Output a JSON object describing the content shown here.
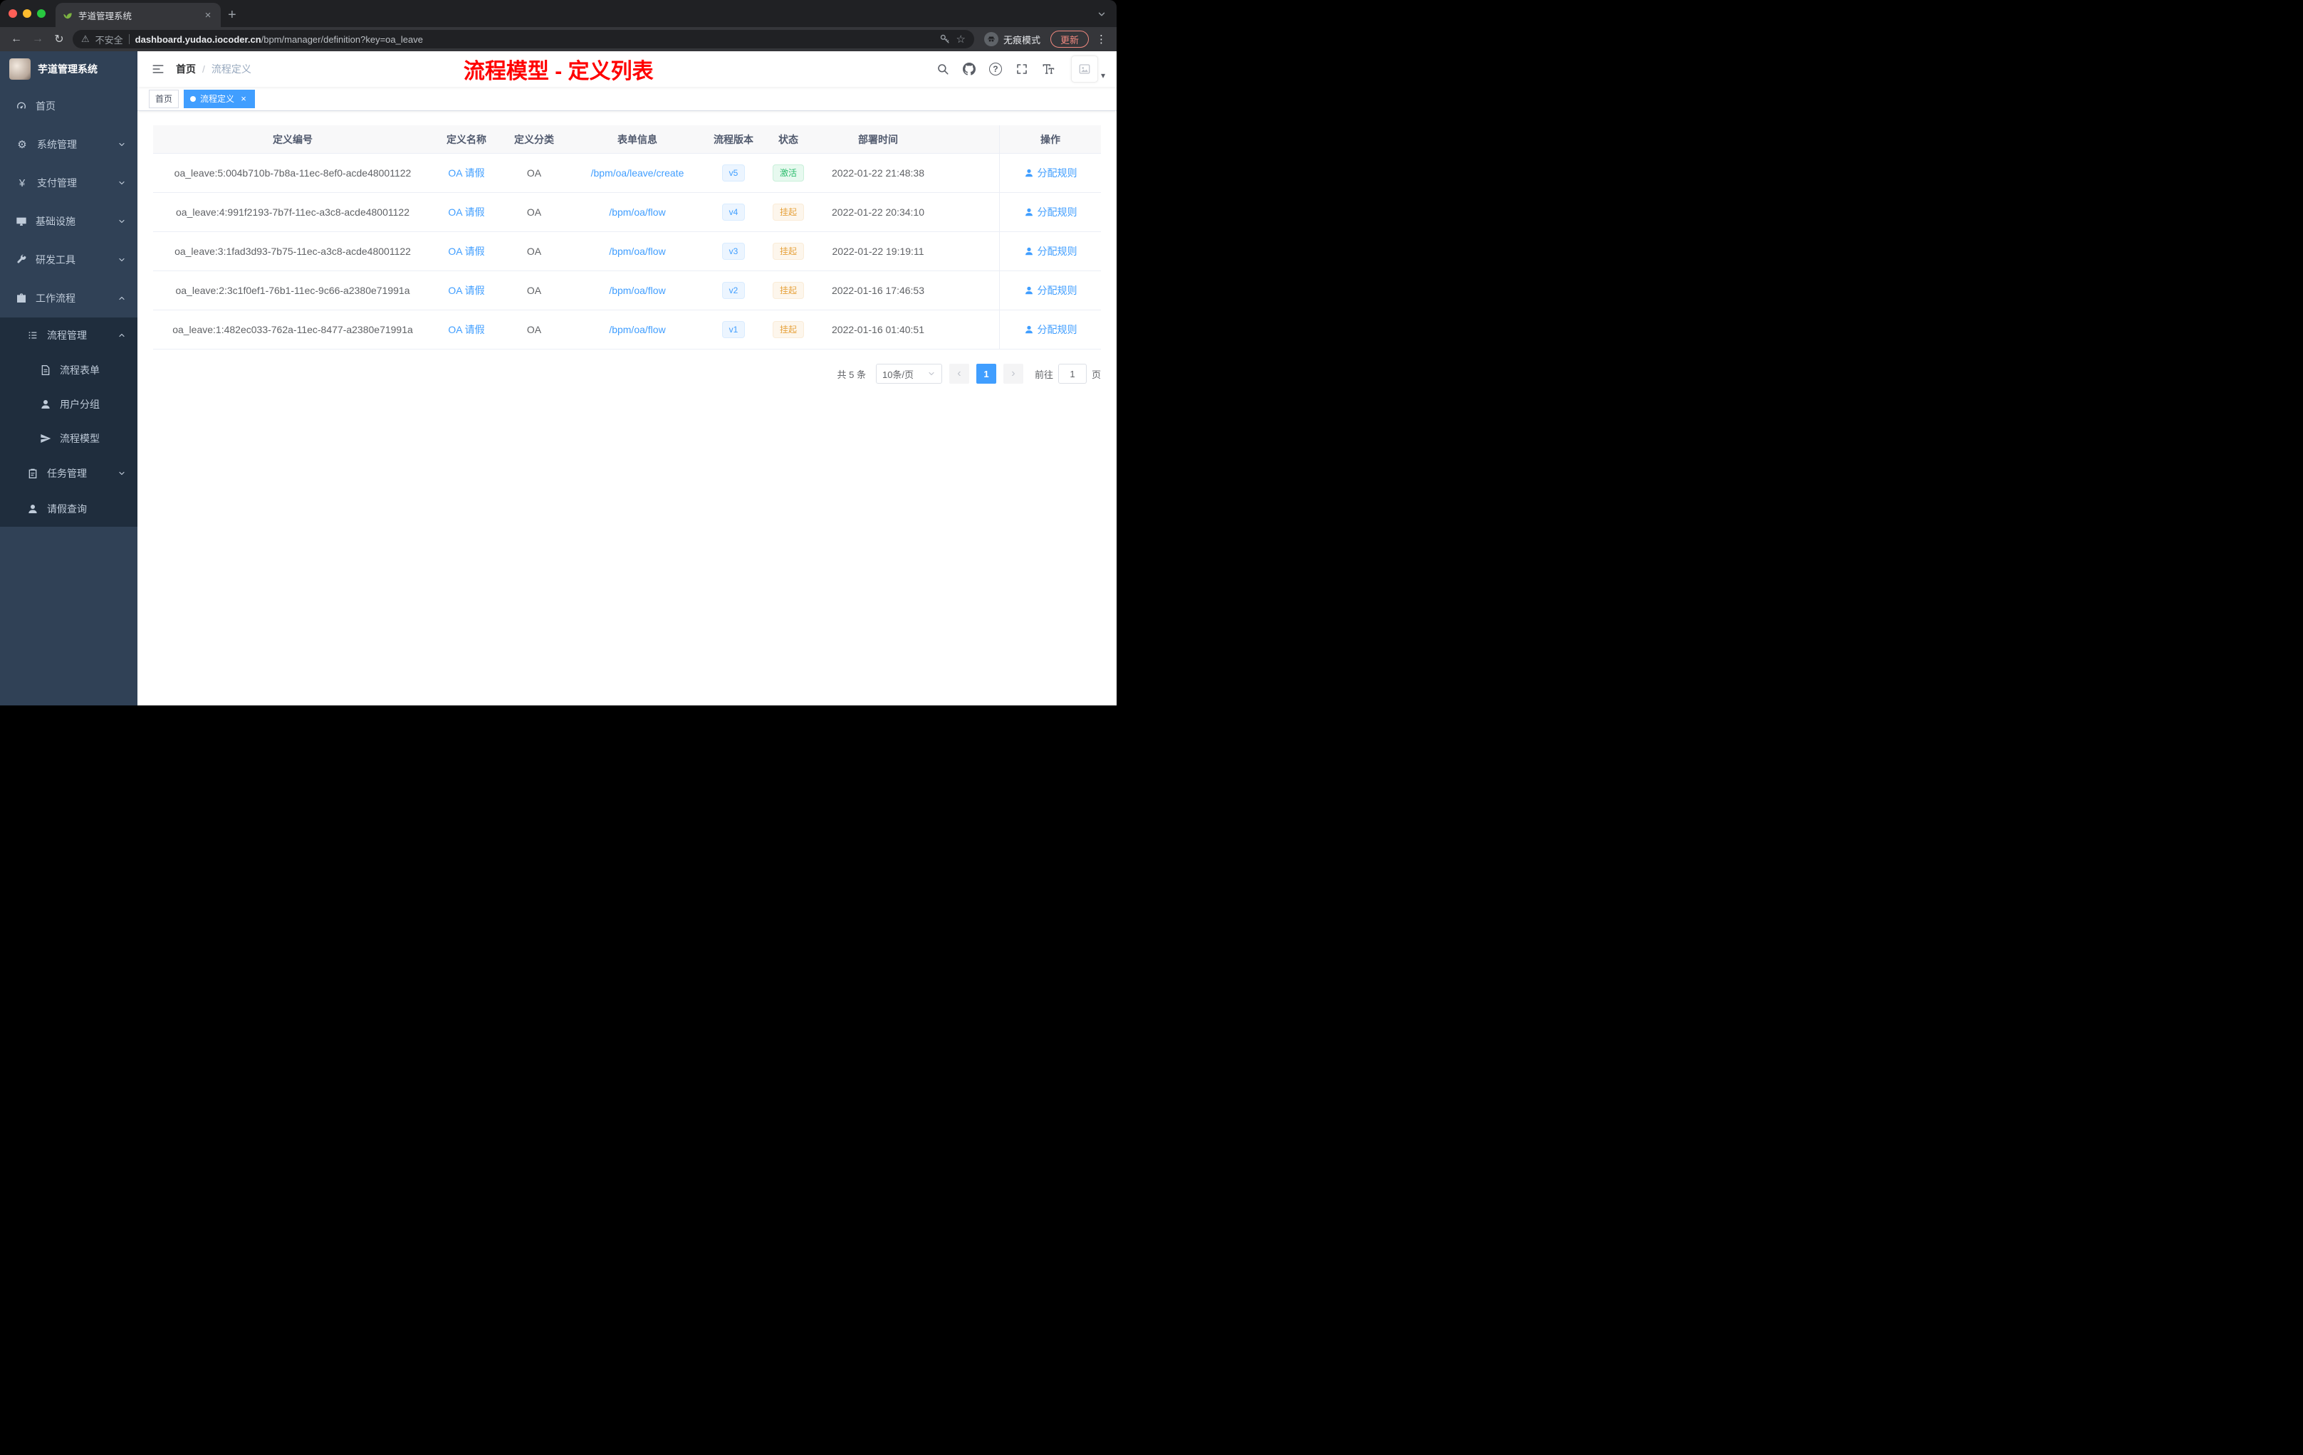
{
  "browser": {
    "tab_title": "芋道管理系统",
    "security_label": "不安全",
    "url_domain": "dashboard.yudao.iocoder.cn",
    "url_path": "/bpm/manager/definition?key=oa_leave",
    "incognito_label": "无痕模式",
    "update_label": "更新"
  },
  "sidebar": {
    "title": "芋道管理系统",
    "menu": [
      {
        "label": "首页"
      },
      {
        "label": "系统管理"
      },
      {
        "label": "支付管理"
      },
      {
        "label": "基础设施"
      },
      {
        "label": "研发工具"
      },
      {
        "label": "工作流程"
      }
    ],
    "submenu": {
      "group": {
        "label": "流程管理"
      },
      "children": [
        {
          "label": "流程表单"
        },
        {
          "label": "用户分组"
        },
        {
          "label": "流程模型"
        }
      ],
      "task": {
        "label": "任务管理"
      },
      "leave": {
        "label": "请假查询"
      }
    }
  },
  "navbar": {
    "breadcrumb": {
      "home": "首页",
      "sep": "/",
      "current": "流程定义"
    },
    "annotation": "流程模型 - 定义列表"
  },
  "tags": {
    "home": "首页",
    "current": "流程定义"
  },
  "table": {
    "columns": [
      "定义编号",
      "定义名称",
      "定义分类",
      "表单信息",
      "流程版本",
      "状态",
      "部署时间",
      "操作"
    ],
    "rows": [
      {
        "id": "oa_leave:5:004b710b-7b8a-11ec-8ef0-acde48001122",
        "name": "OA 请假",
        "category": "OA",
        "form": "/bpm/oa/leave/create",
        "version": "v5",
        "status": "激活",
        "status_type": "success",
        "time": "2022-01-22 21:48:38",
        "action": "分配规则"
      },
      {
        "id": "oa_leave:4:991f2193-7b7f-11ec-a3c8-acde48001122",
        "name": "OA 请假",
        "category": "OA",
        "form": "/bpm/oa/flow",
        "version": "v4",
        "status": "挂起",
        "status_type": "warning",
        "time": "2022-01-22 20:34:10",
        "action": "分配规则"
      },
      {
        "id": "oa_leave:3:1fad3d93-7b75-11ec-a3c8-acde48001122",
        "name": "OA 请假",
        "category": "OA",
        "form": "/bpm/oa/flow",
        "version": "v3",
        "status": "挂起",
        "status_type": "warning",
        "time": "2022-01-22 19:19:11",
        "action": "分配规则"
      },
      {
        "id": "oa_leave:2:3c1f0ef1-76b1-11ec-9c66-a2380e71991a",
        "name": "OA 请假",
        "category": "OA",
        "form": "/bpm/oa/flow",
        "version": "v2",
        "status": "挂起",
        "status_type": "warning",
        "time": "2022-01-16 17:46:53",
        "action": "分配规则"
      },
      {
        "id": "oa_leave:1:482ec033-762a-11ec-8477-a2380e71991a",
        "name": "OA 请假",
        "category": "OA",
        "form": "/bpm/oa/flow",
        "version": "v1",
        "status": "挂起",
        "status_type": "warning",
        "time": "2022-01-16 01:40:51",
        "action": "分配规则"
      }
    ]
  },
  "pagination": {
    "total": "共 5 条",
    "page_size": "10条/页",
    "prev": "‹",
    "page": "1",
    "next": "›",
    "goto_label": "前往",
    "goto_value": "1",
    "page_unit": "页"
  },
  "icons": {
    "gear": "⚙",
    "yen": "¥",
    "close": "×",
    "plus": "+",
    "back": "←",
    "forward": "→",
    "refresh": "↻",
    "star": "☆",
    "warning": "⚠",
    "ellipsis": "⋮",
    "question": "?",
    "caret_down": "▾"
  },
  "colors": {
    "accent": "#409eff",
    "annotation_red": "#ff0000",
    "success": "#2dbd6e",
    "warning": "#e6a23c"
  }
}
